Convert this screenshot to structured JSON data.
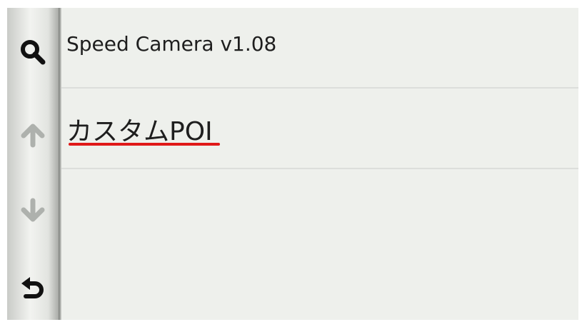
{
  "sidebar": {
    "buttons": [
      {
        "icon": "search-icon",
        "enabled": true
      },
      {
        "icon": "arrow-up-icon",
        "enabled": false
      },
      {
        "icon": "arrow-down-icon",
        "enabled": false
      },
      {
        "icon": "back-icon",
        "enabled": true
      }
    ]
  },
  "list": {
    "items": [
      {
        "label": "Speed Camera v1.08"
      },
      {
        "label": "カスタムPOI",
        "highlighted": true
      }
    ]
  },
  "colors": {
    "background": "#eef0ec",
    "underline": "#e01818",
    "icon_enabled": "#111111",
    "icon_disabled": "#aeb1ad"
  }
}
